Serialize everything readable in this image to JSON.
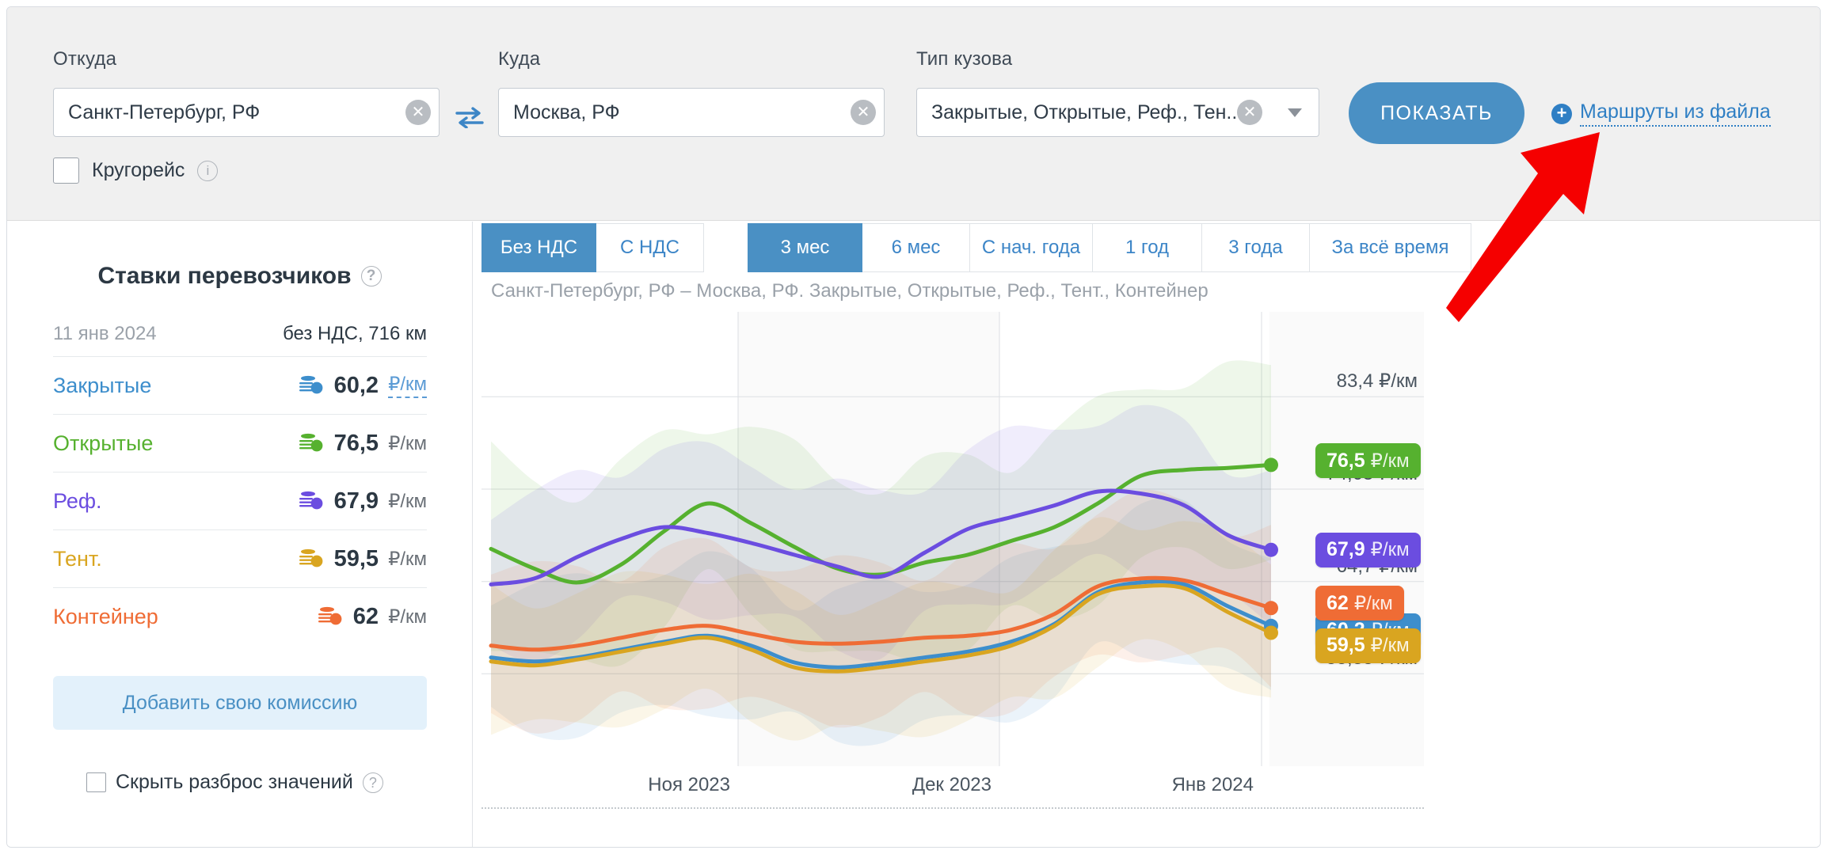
{
  "filters": {
    "from": {
      "label": "Откуда",
      "value": "Санкт-Петербург, РФ",
      "clear": "✕"
    },
    "to": {
      "label": "Куда",
      "value": "Москва, РФ",
      "clear": "✕"
    },
    "body_type": {
      "label": "Тип кузова",
      "value": "Закрытые, Открытые, Реф., Тен...",
      "clear": "✕"
    },
    "swap_icon": "swap-arrows-icon",
    "show_button": "ПОКАЗАТЬ",
    "file_routes_link": "Маршруты из файла",
    "file_routes_icon": "plus-circle-icon",
    "roundtrip": {
      "label": "Кругорейс",
      "checked": false,
      "help": "?"
    }
  },
  "sidebar": {
    "title": "Ставки перевозчиков",
    "title_help": "?",
    "date": "11 янв 2024",
    "meta": "без НДС, 716 км",
    "rows": [
      {
        "name": "Закрытые",
        "amount": "60,2",
        "unit": "₽/км",
        "color": "#3d8ecc",
        "dotted": true
      },
      {
        "name": "Открытые",
        "amount": "76,5",
        "unit": "₽/км",
        "color": "#56b12f",
        "dotted": false
      },
      {
        "name": "Реф.",
        "amount": "67,9",
        "unit": "₽/км",
        "color": "#6b4de0",
        "dotted": false
      },
      {
        "name": "Тент.",
        "amount": "59,5",
        "unit": "₽/км",
        "color": "#d9a520",
        "dotted": false
      },
      {
        "name": "Контейнер",
        "amount": "62",
        "unit": "₽/км",
        "color": "#ef6c35",
        "dotted": false
      }
    ],
    "commission_button": "Добавить свою комиссию",
    "hide_spread": {
      "label": "Скрыть разброс значений",
      "checked": false,
      "help": "?"
    }
  },
  "chart_panel": {
    "vat_tabs": [
      {
        "label": "Без НДС",
        "active": true
      },
      {
        "label": "С НДС",
        "active": false
      }
    ],
    "period_tabs": [
      {
        "label": "3 мес",
        "active": true
      },
      {
        "label": "6 мес",
        "active": false
      },
      {
        "label": "С нач. года",
        "active": false
      },
      {
        "label": "1 год",
        "active": false
      },
      {
        "label": "3 года",
        "active": false
      },
      {
        "label": "За всё время",
        "active": false
      }
    ],
    "subtitle": "Санкт-Петербург, РФ – Москва, РФ. Закрытые, Открытые, Реф., Тент., Контейнер"
  },
  "annotation": {
    "arrow": "red-arrow-pointing-to-file-routes-link",
    "color": "#f50000"
  },
  "chart_data": {
    "type": "line",
    "title": "Ставки перевозчиков",
    "subtitle": "Санкт-Петербург, РФ – Москва, РФ. Закрытые, Открытые, Реф., Тент., Контейнер",
    "xlabel": "",
    "ylabel": "₽/км",
    "grid": true,
    "legend_position": "right-badges",
    "ylim": [
      46.0,
      92.0
    ],
    "ytick_labels": [
      "83,4 ₽/км",
      "74,05 ₽/км",
      "64,7 ₽/км",
      "55,35 ₽/км"
    ],
    "yticks": [
      83.4,
      74.05,
      64.7,
      55.35
    ],
    "xtick_labels": [
      "Ноя 2023",
      "Дек 2023",
      "Янв 2024"
    ],
    "x": [
      "2023-10-12",
      "2023-10-17",
      "2023-10-22",
      "2023-10-27",
      "2023-11-01",
      "2023-11-06",
      "2023-11-11",
      "2023-11-16",
      "2023-11-21",
      "2023-11-26",
      "2023-12-01",
      "2023-12-06",
      "2023-12-11",
      "2023-12-16",
      "2023-12-21",
      "2023-12-26",
      "2023-12-31",
      "2024-01-05",
      "2024-01-11"
    ],
    "series": [
      {
        "name": "Закрытые",
        "color": "#3d8ecc",
        "end_label": "60,2 ₽/км",
        "values": [
          57.0,
          56.6,
          57.0,
          57.8,
          58.6,
          59.2,
          58.2,
          56.5,
          56.0,
          56.4,
          57.0,
          57.6,
          58.6,
          60.4,
          63.6,
          64.6,
          64.4,
          62.2,
          60.2
        ]
      },
      {
        "name": "Открытые",
        "color": "#56b12f",
        "end_label": "76,5 ₽/км",
        "values": [
          68.0,
          66.0,
          64.6,
          66.4,
          69.8,
          72.6,
          70.6,
          68.2,
          66.0,
          65.4,
          66.6,
          67.4,
          68.8,
          70.2,
          72.6,
          75.4,
          76.0,
          76.2,
          76.5
        ]
      },
      {
        "name": "Реф.",
        "color": "#6b4de0",
        "end_label": "67,9 ₽/км",
        "values": [
          64.4,
          65.0,
          67.2,
          69.0,
          70.2,
          69.6,
          68.6,
          67.4,
          66.2,
          65.2,
          67.6,
          70.0,
          71.2,
          72.4,
          73.8,
          73.6,
          72.4,
          69.4,
          67.9
        ]
      },
      {
        "name": "Тент.",
        "color": "#d9a520",
        "end_label": "59,5 ₽/км",
        "values": [
          56.6,
          56.2,
          56.8,
          57.6,
          58.4,
          59.0,
          57.8,
          56.0,
          55.6,
          56.0,
          56.6,
          57.2,
          58.2,
          60.2,
          63.4,
          64.2,
          64.0,
          61.6,
          59.5
        ]
      },
      {
        "name": "Контейнер",
        "color": "#ef6c35",
        "end_label": "62 ₽/км",
        "values": [
          58.2,
          57.8,
          58.2,
          59.0,
          59.8,
          60.2,
          59.4,
          58.6,
          58.4,
          58.6,
          59.0,
          59.2,
          59.8,
          61.4,
          64.2,
          65.0,
          64.8,
          63.4,
          62.0
        ]
      }
    ],
    "bands_note": "Each series has a shaded min–max spread band"
  }
}
